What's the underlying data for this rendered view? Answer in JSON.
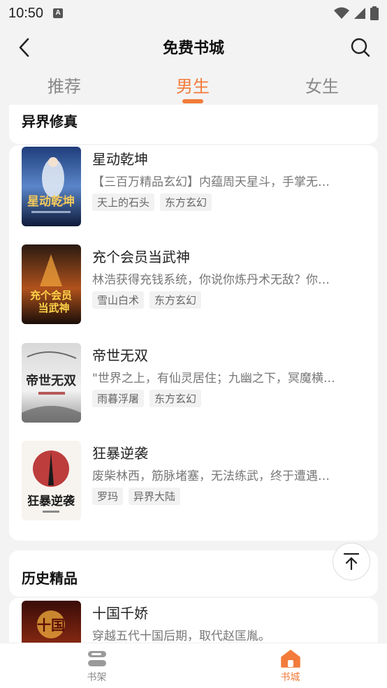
{
  "status": {
    "time": "10:50",
    "notification": "A"
  },
  "header": {
    "title": "免费书城",
    "back_icon": "chevron-left-icon",
    "search_icon": "search-icon"
  },
  "tabs": [
    {
      "label": "推荐",
      "active": false
    },
    {
      "label": "男生",
      "active": true
    },
    {
      "label": "女生",
      "active": false
    }
  ],
  "sections": [
    {
      "title": "异界修真",
      "books": [
        {
          "name": "星动乾坤",
          "desc": "【三百万精品玄幻】内蕴周天星斗，手掌无…",
          "tags": [
            "天上的石头",
            "东方玄幻"
          ]
        },
        {
          "name": "充个会员当武神",
          "desc": "林浩获得充钱系统，你说你炼丹术无敌？你…",
          "tags": [
            "雪山白术",
            "东方玄幻"
          ]
        },
        {
          "name": "帝世无双",
          "desc": "\"世界之上，有仙灵居住；九幽之下，冥魔横…",
          "tags": [
            "雨暮浮屠",
            "东方玄幻"
          ]
        },
        {
          "name": "狂暴逆袭",
          "desc": "废柴林西，筋脉堵塞，无法练武，终于遭遇…",
          "tags": [
            "罗玛",
            "异界大陆"
          ]
        }
      ]
    },
    {
      "title": "历史精品",
      "books": [
        {
          "name": "十国千娇",
          "desc": "穿越五代十国后期，取代赵匡胤。",
          "tags": []
        }
      ]
    }
  ],
  "bottom_nav": [
    {
      "label": "书架",
      "icon": "bookshelf-icon",
      "active": false
    },
    {
      "label": "书城",
      "icon": "home-icon",
      "active": true
    }
  ],
  "colors": {
    "accent": "#f27b3a",
    "inactive": "#888888"
  }
}
